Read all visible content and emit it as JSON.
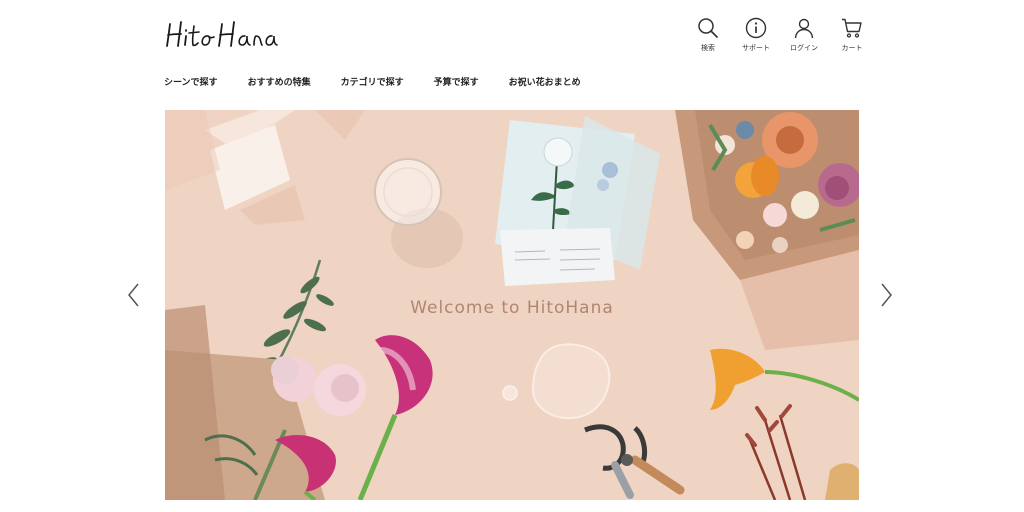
{
  "brand": {
    "name": "HitoHana"
  },
  "header": {
    "icons": [
      {
        "icon": "search-icon",
        "label": "検索"
      },
      {
        "icon": "info-icon",
        "label": "サポート"
      },
      {
        "icon": "user-icon",
        "label": "ログイン"
      },
      {
        "icon": "cart-icon",
        "label": "カート"
      }
    ]
  },
  "nav": {
    "items": [
      {
        "label": "シーンで探す"
      },
      {
        "label": "おすすめの特集"
      },
      {
        "label": "カテゴリで探す"
      },
      {
        "label": "予算で探す"
      },
      {
        "label": "お祝い花おまとめ"
      }
    ]
  },
  "hero": {
    "title": "Welcome to HitoHana",
    "background": "#f0d4c3"
  },
  "colors": {
    "accent": "#b08672",
    "text": "#222222"
  }
}
